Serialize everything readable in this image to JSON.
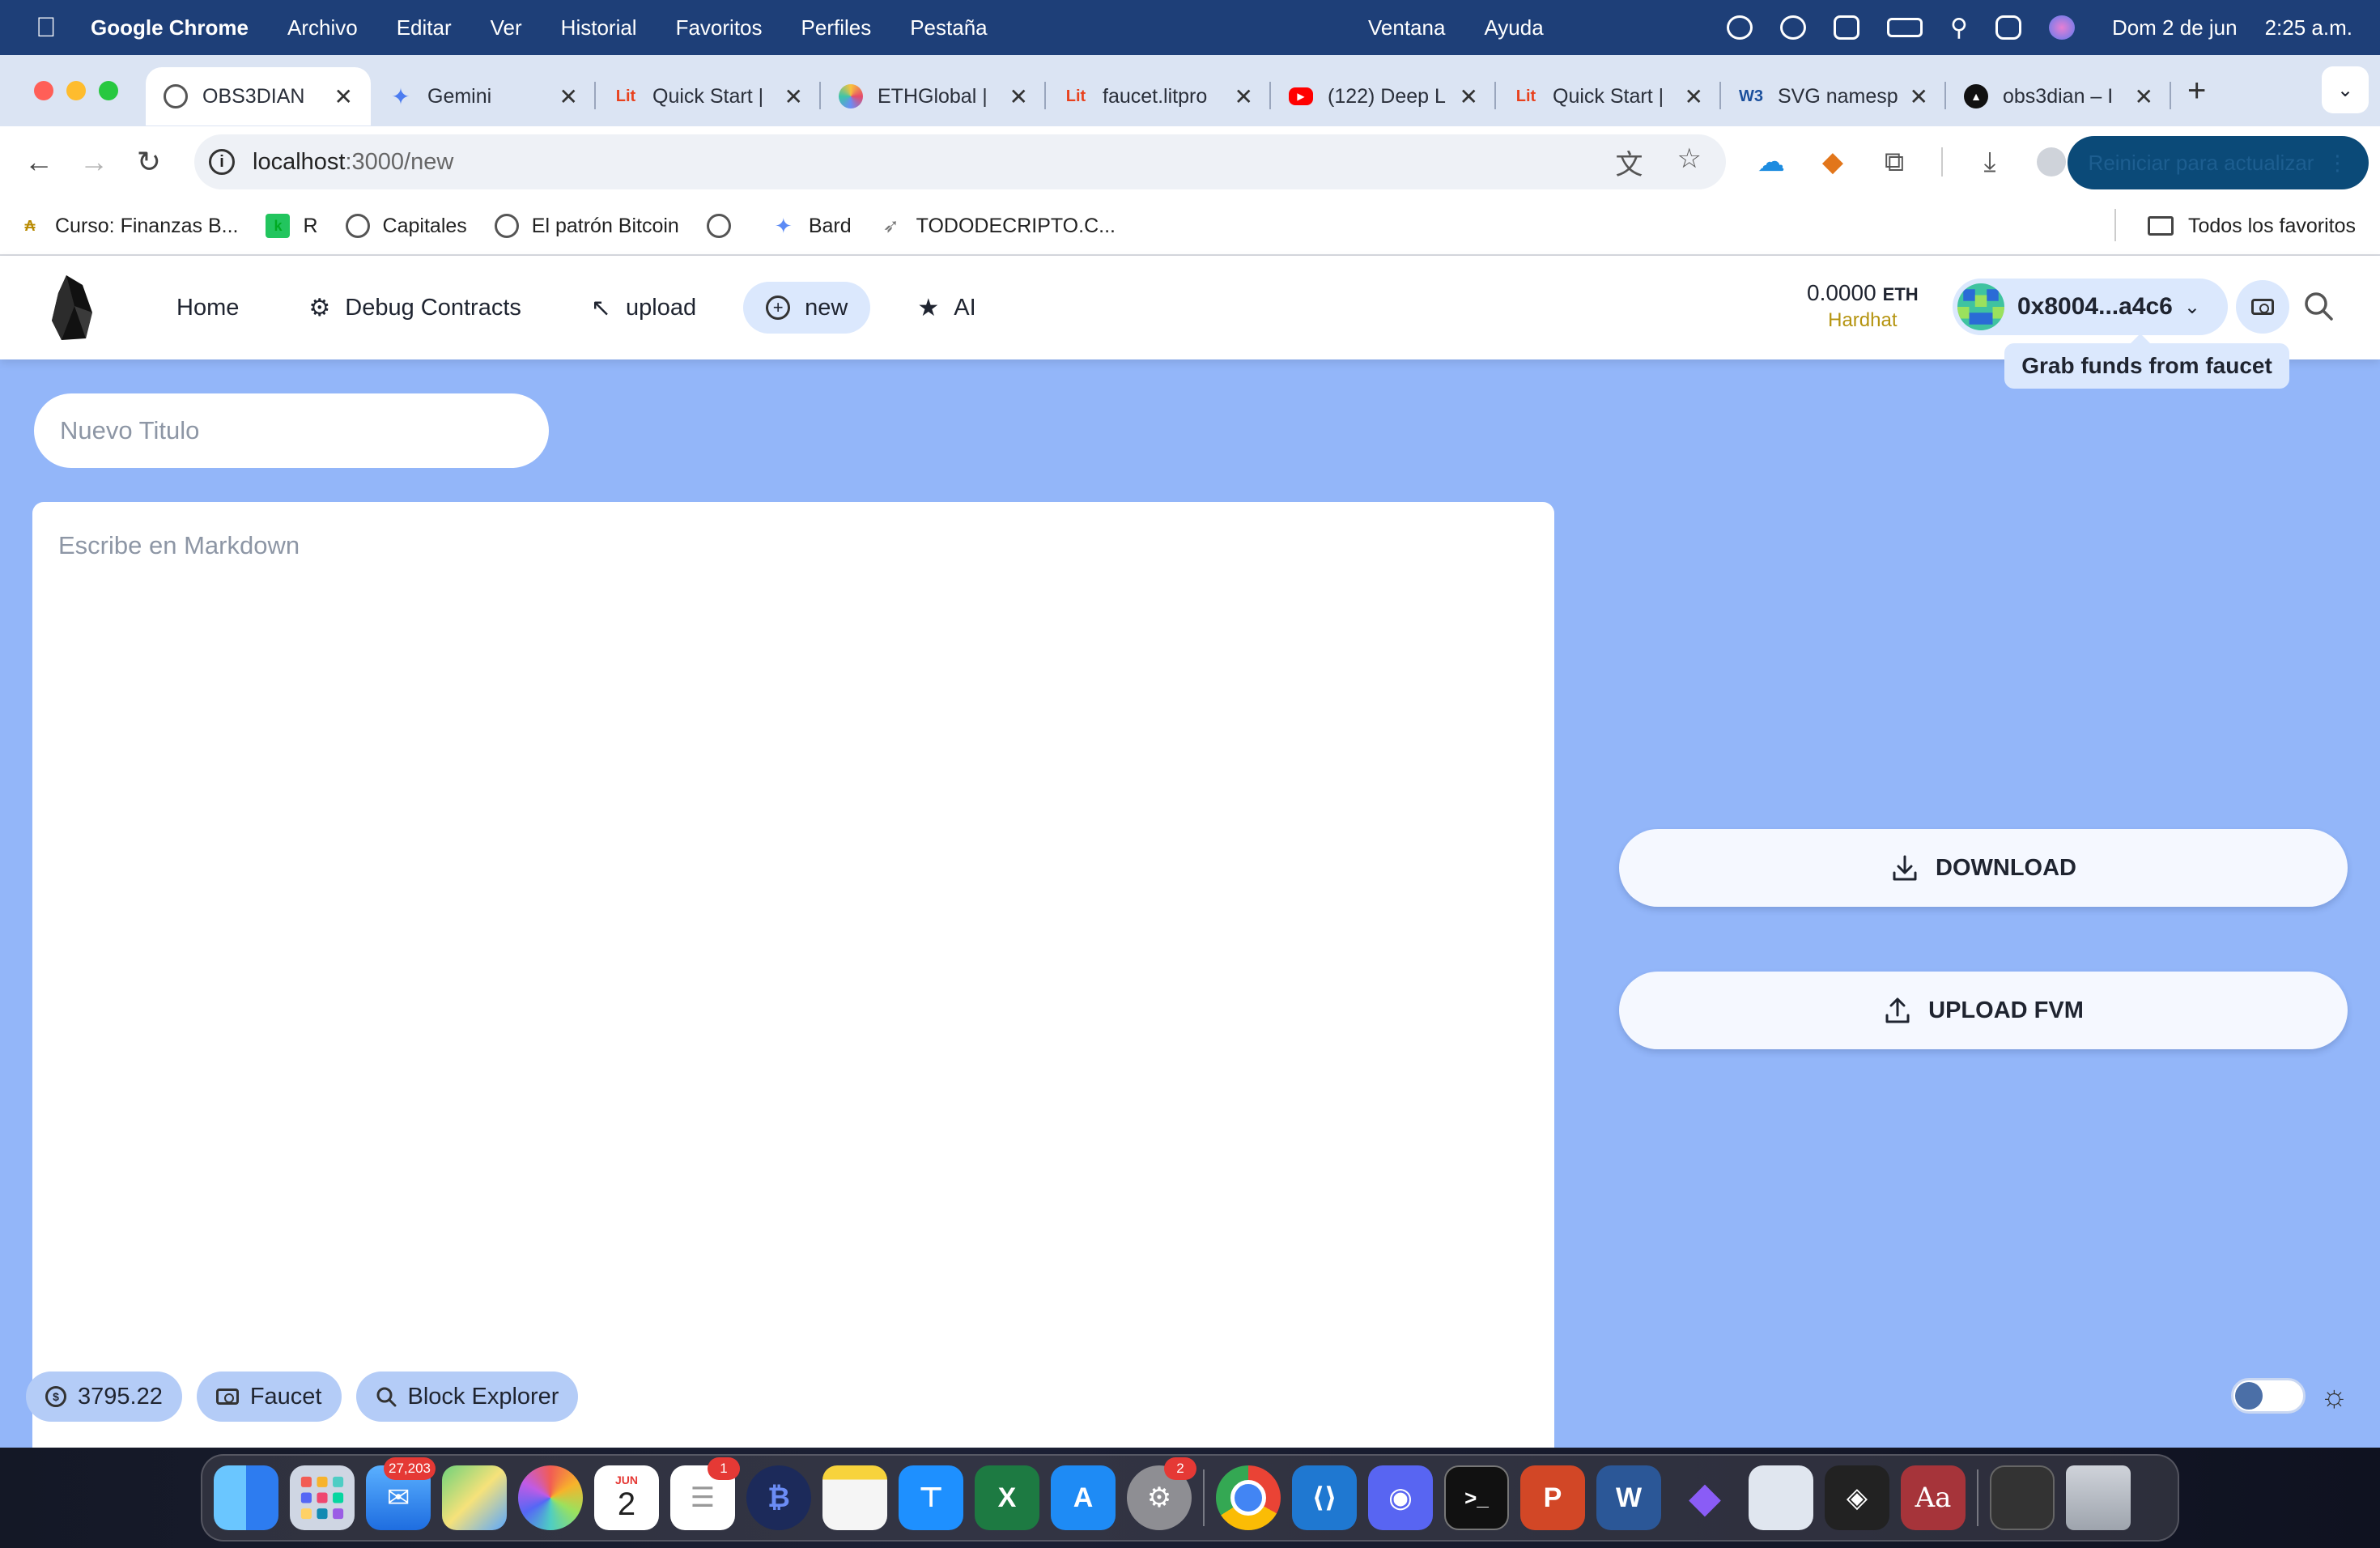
{
  "menubar": {
    "app_name": "Google Chrome",
    "menus": [
      "Archivo",
      "Editar",
      "Ver",
      "Historial",
      "Favoritos",
      "Perfiles",
      "Pestaña"
    ],
    "center_menus": [
      "Ventana",
      "Ayuda"
    ],
    "date": "Dom 2 de jun",
    "time": "2:25 a.m."
  },
  "tabs": [
    {
      "title": "OBS3DIAN",
      "icon": "globe-icon",
      "active": true
    },
    {
      "title": "Gemini",
      "icon": "gemini-icon"
    },
    {
      "title": "Quick Start |",
      "icon": "lit-icon"
    },
    {
      "title": "ETHGlobal |",
      "icon": "ethglobal-icon"
    },
    {
      "title": "faucet.litpro",
      "icon": "lit-icon"
    },
    {
      "title": "(122) Deep L",
      "icon": "youtube-icon"
    },
    {
      "title": "Quick Start |",
      "icon": "lit-icon"
    },
    {
      "title": "SVG namesp",
      "icon": "w3-icon"
    },
    {
      "title": "obs3dian – I",
      "icon": "vercel-icon"
    }
  ],
  "toolbar": {
    "url_host": "localhost",
    "url_path": ":3000/new",
    "reload_label": "Reiniciar para actualizar"
  },
  "bookmarks": {
    "items": [
      {
        "label": "Curso: Finanzas B...",
        "icon": "finance-icon"
      },
      {
        "label": "R",
        "icon": "r-icon"
      },
      {
        "label": "Capitales",
        "icon": "globe-icon"
      },
      {
        "label": "El patrón Bitcoin",
        "icon": "globe-icon"
      },
      {
        "label": "",
        "icon": "globe-icon"
      },
      {
        "label": "Bard",
        "icon": "bard-icon"
      },
      {
        "label": "TODODECRIPTO.C...",
        "icon": "rocket-icon"
      }
    ],
    "all_label": "Todos los favoritos"
  },
  "app": {
    "nav": [
      {
        "label": "Home",
        "icon": ""
      },
      {
        "label": "Debug Contracts",
        "icon": "bug-icon"
      },
      {
        "label": "upload",
        "icon": "arrow-up-left-icon"
      },
      {
        "label": "new",
        "icon": "plus-circle-icon",
        "active": true
      },
      {
        "label": "AI",
        "icon": "star-icon"
      }
    ],
    "balance": "0.0000",
    "balance_unit": "ETH",
    "network": "Hardhat",
    "address": "0x8004...a4c6",
    "faucet_tooltip": "Grab funds from faucet",
    "title_placeholder": "Nuevo Titulo",
    "editor_placeholder": "Escribe en Markdown",
    "download_label": "DOWNLOAD",
    "upload_label": "UPLOAD FVM",
    "footer": {
      "price": "3795.22",
      "faucet_label": "Faucet",
      "explorer_label": "Block Explorer"
    }
  },
  "dock": {
    "mail_badge": "27,203",
    "reminders_badge": "1",
    "settings_badge": "2",
    "calendar_month": "JUN",
    "calendar_day": "2",
    "dictionary_label": "Aa"
  },
  "colors": {
    "page_bg": "#93b6f9",
    "accent_pill": "#dbe8fd",
    "network": "#b59410",
    "menubar": "#1e3f78"
  }
}
